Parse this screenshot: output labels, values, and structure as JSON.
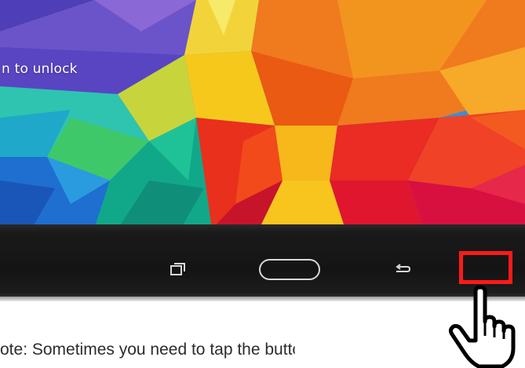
{
  "lock_screen": {
    "unlock_hint": "n to unlock",
    "wallpaper": "polygonal colorful wallpaper"
  },
  "nav_bar": {
    "recent_apps_icon": "recent-apps-icon",
    "home_button": "home-button",
    "back_icon": "back-arrow-icon"
  },
  "annotation": {
    "highlight_color": "#ff1a1a",
    "pointer_icon": "hand-pointer-icon"
  },
  "caption": {
    "text": "ote: Sometimes you need to tap the button twice in"
  }
}
